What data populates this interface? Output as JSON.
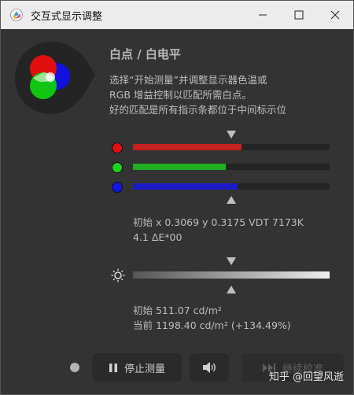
{
  "window": {
    "title": "交互式显示调整"
  },
  "panel": {
    "heading": "白点 / 白电平",
    "description_lines": [
      "选择“开始测量”并调整显示器色温或",
      "RGB 增益控制以匹配所需白点。",
      "好的匹配是所有指示条都位于中间标示位"
    ]
  },
  "rgb_bars": {
    "red": {
      "level": 0.55,
      "color": "#c42020",
      "dot_color": "#e01010"
    },
    "green": {
      "level": 0.47,
      "color": "#1fae1f",
      "dot_color": "#20d020"
    },
    "blue": {
      "level": 0.53,
      "color": "#1b1bc4",
      "dot_color": "#1515e0"
    }
  },
  "white_point_info": {
    "line1": "初始 x 0.3069 y 0.3175 VDT 7173K",
    "line2": "4.1 ΔE*00"
  },
  "luminance": {
    "level": 1.0,
    "line1": "初始 511.07 cd/m²",
    "line2": "当前 1198.40 cd/m² (+134.49%)"
  },
  "buttons": {
    "stop": "停止测量",
    "next": "继续校准"
  },
  "watermark": "知乎 @回望风逝",
  "icons": {
    "app": "color-calibration-icon",
    "minimize": "minimize-icon",
    "maximize": "maximize-icon",
    "close": "close-icon",
    "brightness": "sun-icon",
    "pause": "pause-icon",
    "speaker": "speaker-icon",
    "skip": "skip-forward-icon"
  }
}
